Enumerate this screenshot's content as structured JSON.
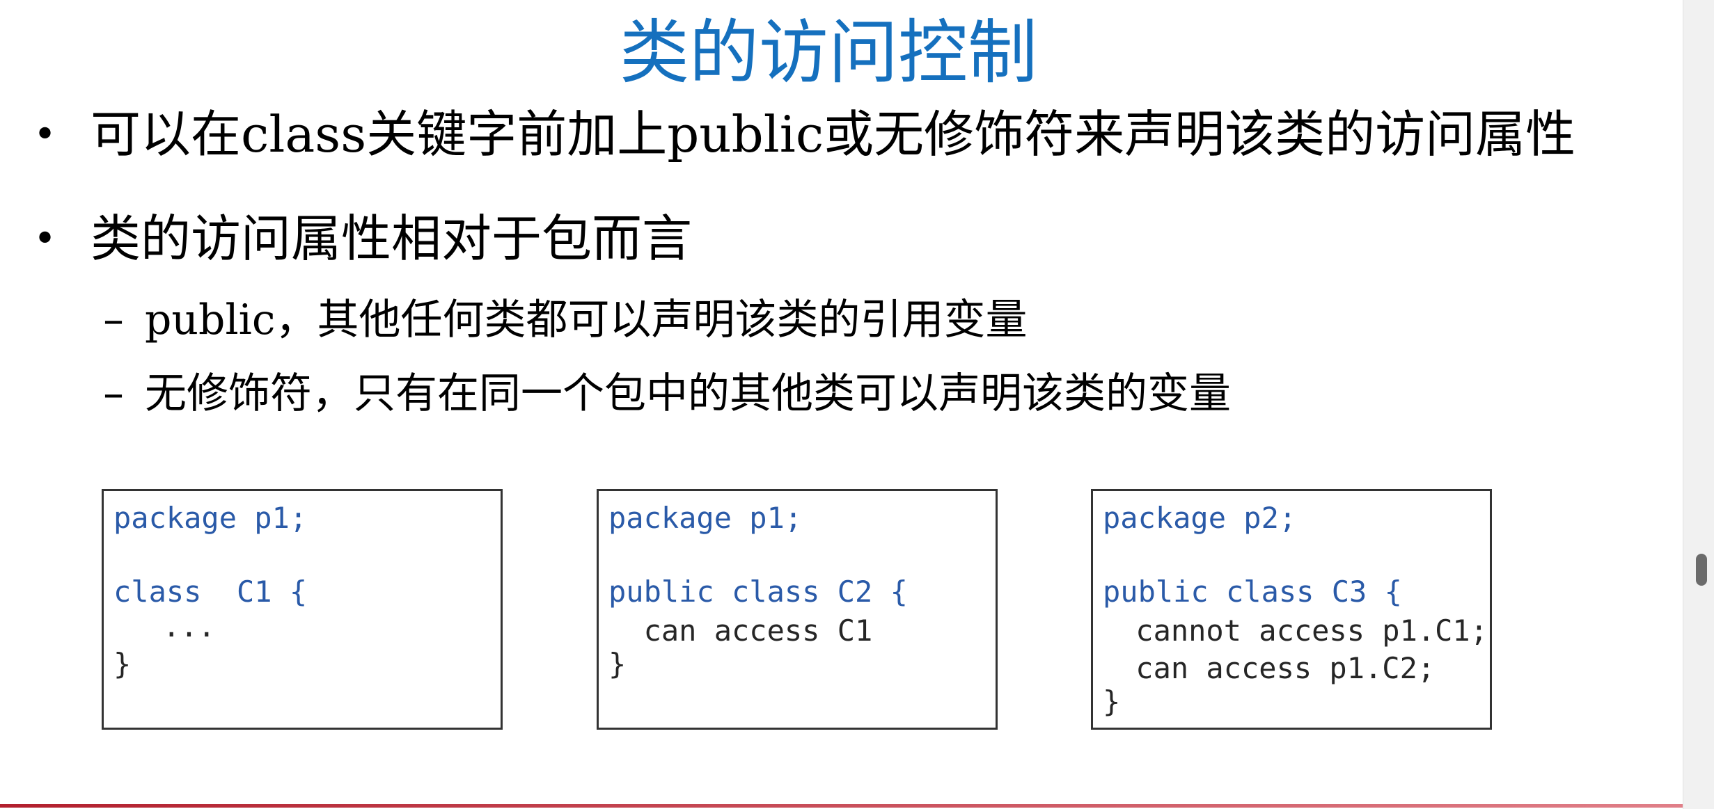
{
  "slide": {
    "title": "类的访问控制",
    "bullet1": {
      "part1": "可以在",
      "word1": "class",
      "part2": "关键字前加上",
      "word2": "public",
      "part3": "或无修饰符来声明该类的访问属性"
    },
    "bullet2": "类的访问属性相对于包而言",
    "sub1": {
      "word": "public",
      "rest": "，其他任何类都可以声明该类的引用变量"
    },
    "sub2": "无修饰符，只有在同一个包中的其他类可以声明该类的变量",
    "bullet_symbol": "•",
    "dash_symbol": "–"
  },
  "code_boxes": [
    {
      "line1": "package p1;",
      "line2": "class  C1 {",
      "line3": "  ...",
      "line4": "}"
    },
    {
      "line1": "package p1;",
      "line2": "public class C2 {",
      "line3": "  can access C1",
      "line4": "}"
    },
    {
      "line1": "package p2;",
      "line2": "public class C3 {",
      "line3": " cannot access p1.C1;",
      "line4": " can access p1.C2;",
      "line5": "}"
    }
  ],
  "colors": {
    "title": "#1570be",
    "code_keyword": "#2a5aa8",
    "code_text": "#262626",
    "bottom_rule": "#b21f2d"
  }
}
